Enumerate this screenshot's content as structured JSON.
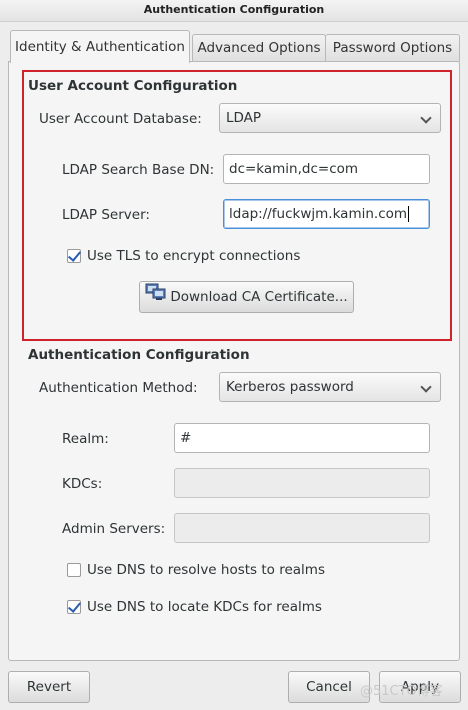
{
  "window": {
    "title": "Authentication Configuration"
  },
  "tabs": [
    {
      "label": "Identity & Authentication",
      "active": true
    },
    {
      "label": "Advanced Options",
      "active": false
    },
    {
      "label": "Password Options",
      "active": false
    }
  ],
  "user_account": {
    "section_title": "User Account Configuration",
    "database_label": "User Account Database:",
    "database_value": "LDAP",
    "search_base_label": "LDAP Search Base DN:",
    "search_base_value": "dc=kamin,dc=com",
    "server_label": "LDAP Server:",
    "server_value": "ldap://fuckwjm.kamin.com",
    "tls_label": "Use TLS to encrypt connections",
    "tls_checked": true,
    "download_ca_label": "Download CA Certificate..."
  },
  "auth": {
    "section_title": "Authentication Configuration",
    "method_label": "Authentication Method:",
    "method_value": "Kerberos password",
    "realm_label": "Realm:",
    "realm_value": "#",
    "kdcs_label": "KDCs:",
    "kdcs_value": "",
    "admin_label": "Admin Servers:",
    "admin_value": "",
    "dns_hosts_label": "Use DNS to resolve hosts to realms",
    "dns_hosts_checked": false,
    "dns_kdcs_label": "Use DNS to locate KDCs for realms",
    "dns_kdcs_checked": true
  },
  "footer": {
    "revert_label": "Revert",
    "cancel_label": "Cancel",
    "apply_label": "Apply"
  },
  "watermark": "@51CTO博客",
  "icons": {
    "download_ca": "network-computers-icon",
    "dropdown": "chevron-down-icon"
  },
  "colors": {
    "highlight_border": "#d0222b",
    "check_mark": "#2a5db0",
    "focus_border": "#4a90d9"
  }
}
